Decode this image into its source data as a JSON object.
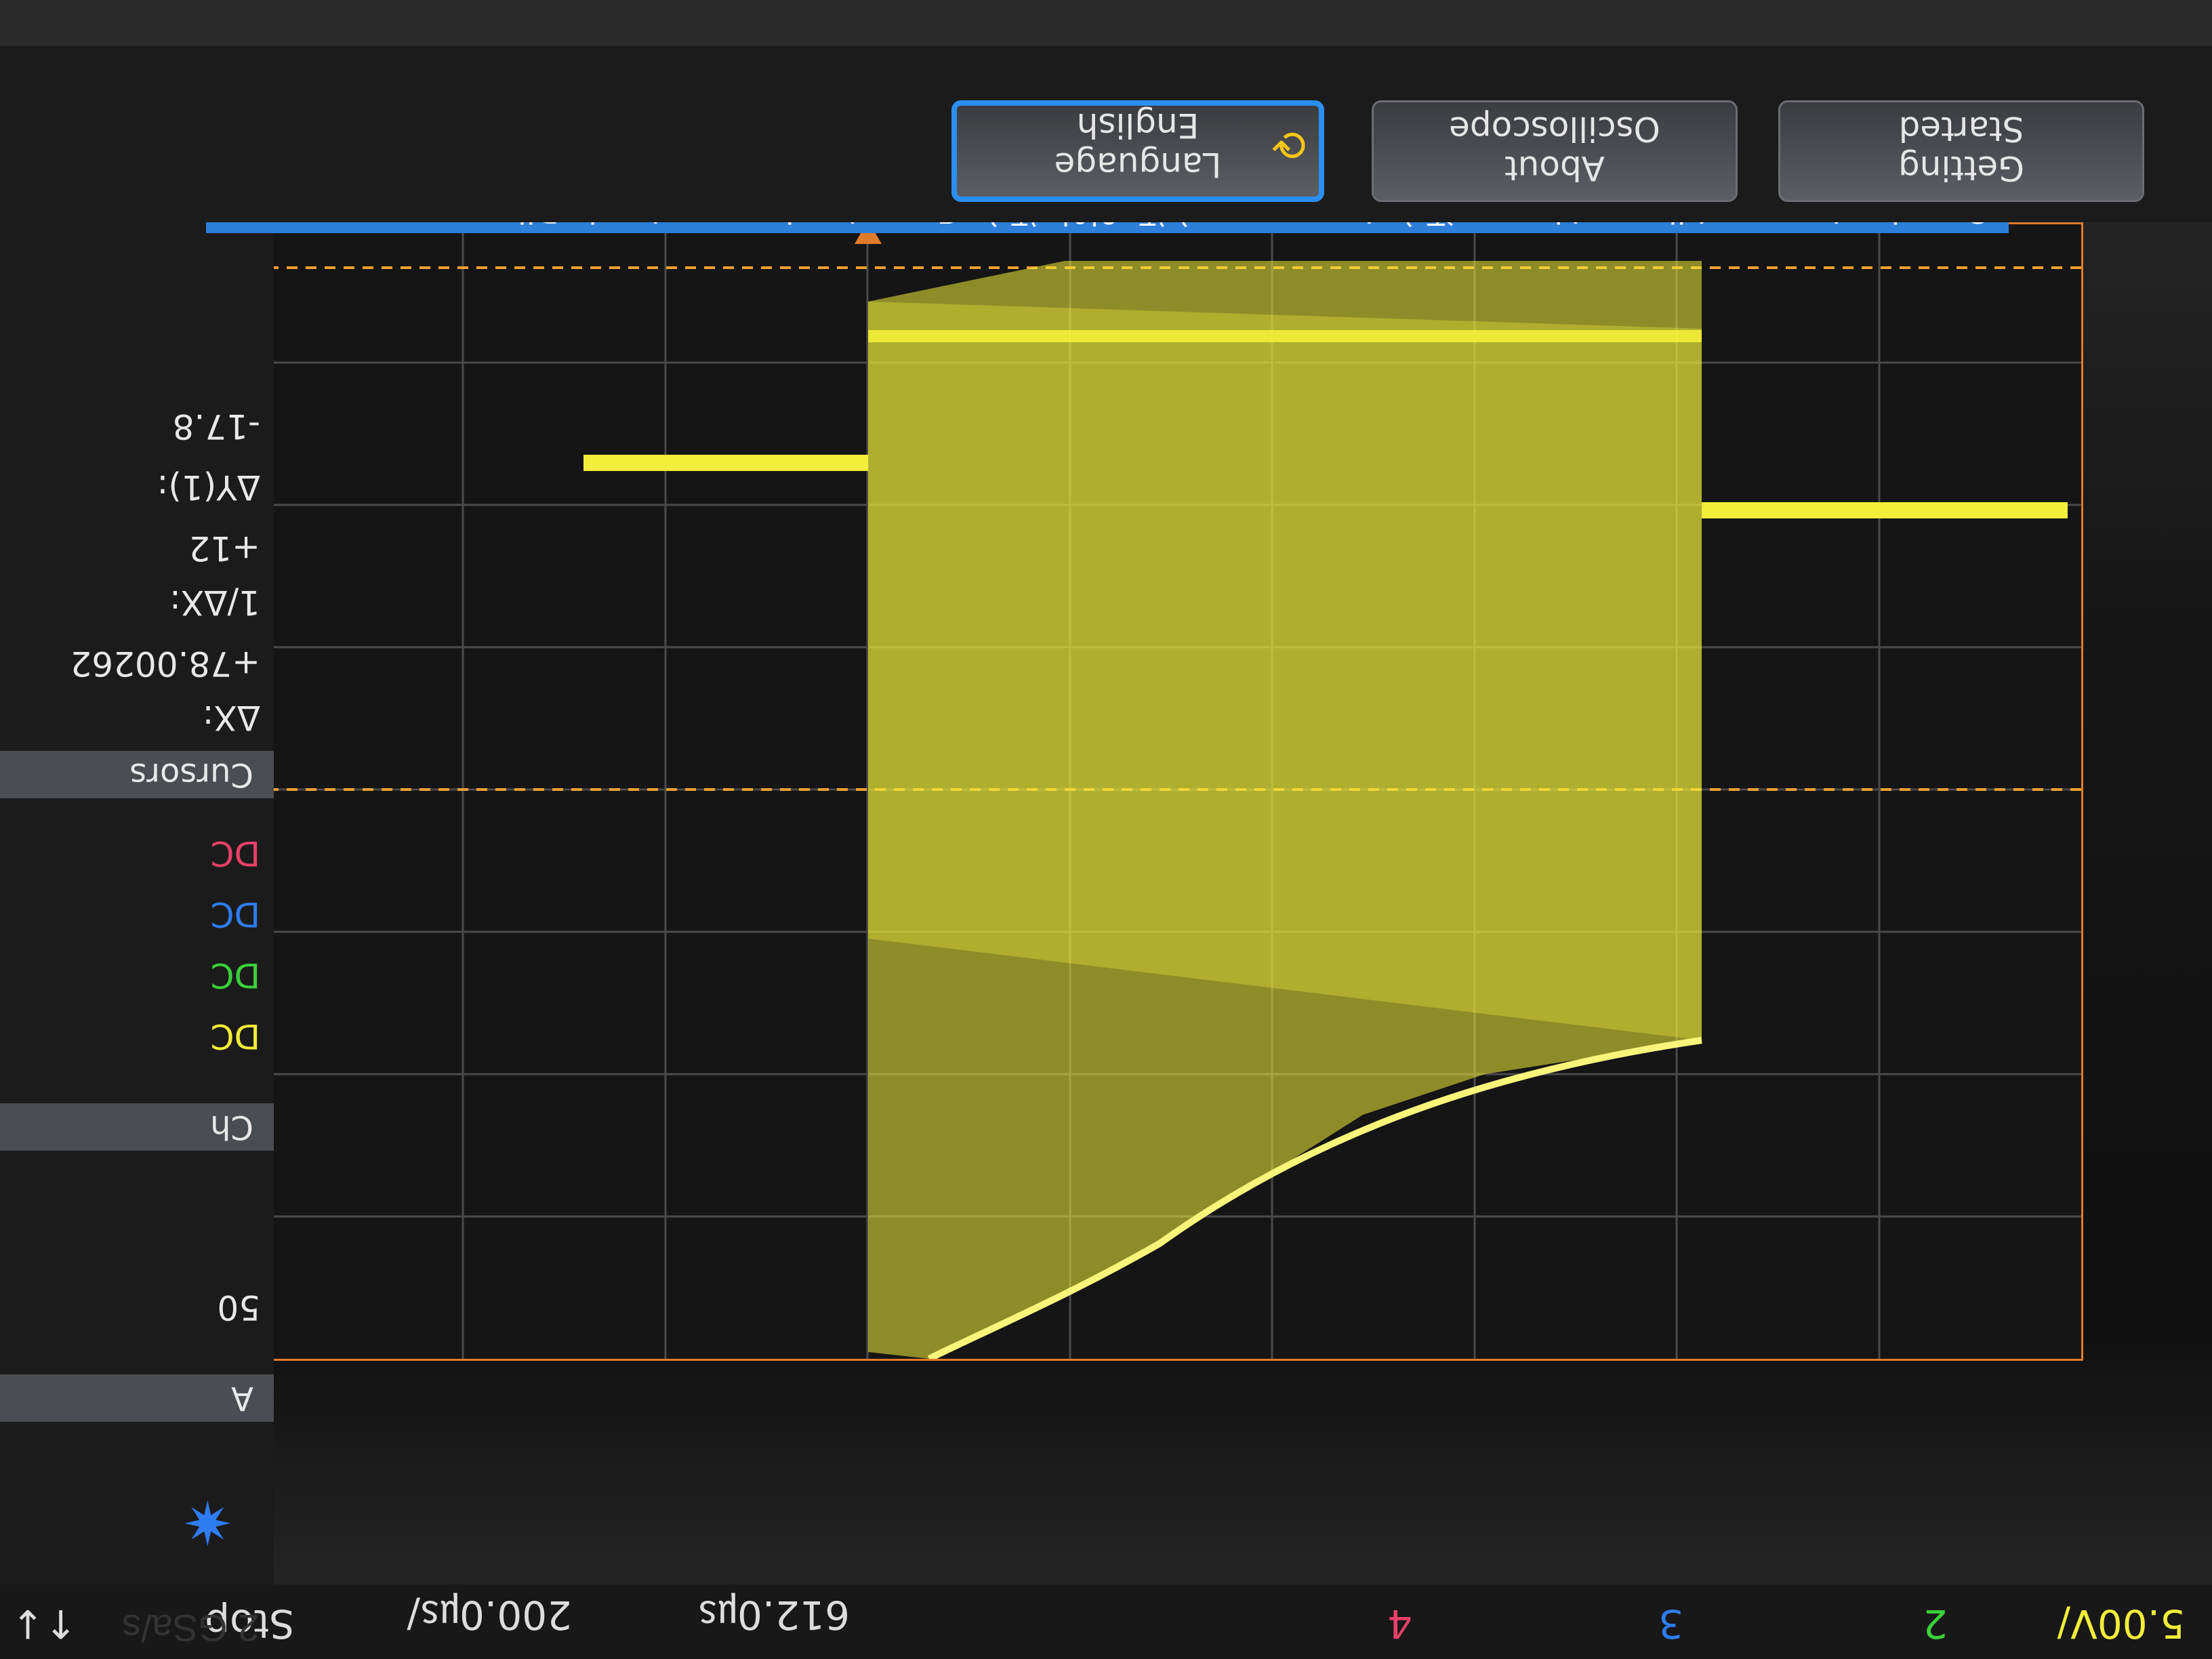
{
  "instrument": {
    "sample_rate": "2 GSa/s"
  },
  "softkeys": [
    {
      "id": "getting-started",
      "line1": "Getting",
      "line2": "Started"
    },
    {
      "id": "about-oscilloscope",
      "line1": "About",
      "line2": "Oscilloscope"
    },
    {
      "id": "language",
      "line1": "Language",
      "line2": "English",
      "active": true
    }
  ],
  "language_banner": "Sprache, Langue, Idioma, Lingua, 语言, Language, 言語, 언어, 語言, Язык, Język, ภาษา, Jazyk, Dil",
  "status": {
    "ch1_scale": "5.00V/",
    "ch2_label": "2",
    "ch3_label": "3",
    "ch4_label": "4",
    "time_delay": "612.0㎲",
    "time_scale": "200.0㎲/",
    "run_state": "Stop",
    "trigger_icon": "↑↓"
  },
  "side_panel": {
    "cursors_header": "Cursors",
    "delta_x_label": "ΔX:",
    "delta_x_value": "+78.00262",
    "inv_delta_x_label": "1/ΔX:",
    "inv_delta_x_value": "+12",
    "delta_y_label": "ΔY(1):",
    "delta_y_value": "-17.8",
    "channels_header": "Ch",
    "coupling": [
      "DC",
      "DC",
      "DC",
      "DC"
    ],
    "acq_header": "A",
    "acq_value": "50"
  },
  "colors": {
    "ch1": "#f2ee3a",
    "ch2": "#3ad13a",
    "ch3": "#2f7cf0",
    "ch4": "#e8406a",
    "grid": "#5a5a5a",
    "cursor": "#f0a030",
    "banner": "#2e7fd9"
  },
  "icons": {
    "language_refresh": "refresh-icon",
    "drag_handle": "grip-dots-icon",
    "logo": "starburst-logo-icon"
  }
}
